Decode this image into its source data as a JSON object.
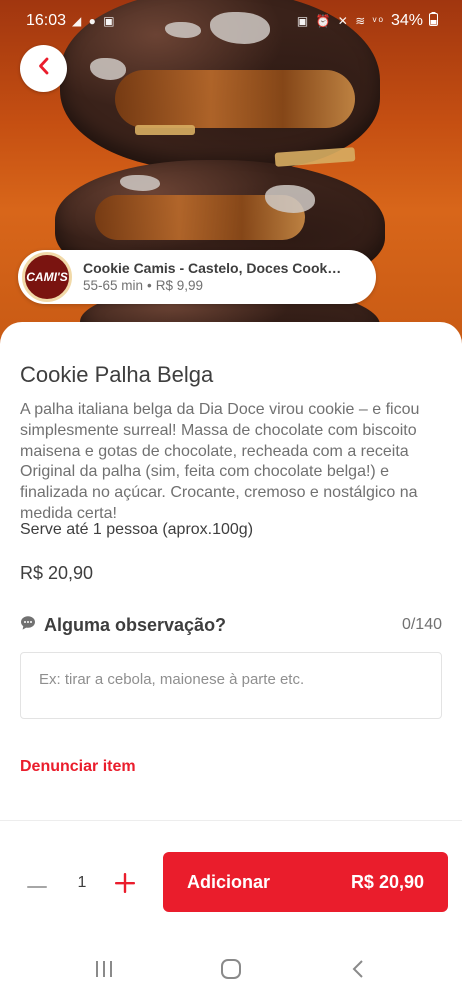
{
  "status_bar": {
    "time": "16:03",
    "notification_icons": "◢ ● ▣",
    "system_icons": "▣ ⏰ ✕ ≋ ᵛᵒ",
    "battery": "34%"
  },
  "merchant": {
    "logo_text": "CAMI'S",
    "name": "Cookie Camis - Castelo, Doces Cookies ...",
    "delivery_time": "55-65 min",
    "separator": "•",
    "delivery_fee": "R$ 9,99"
  },
  "product": {
    "title": "Cookie Palha Belga",
    "description": "A palha italiana belga da Dia Doce virou cookie – e ficou simplesmente surreal! Massa de chocolate com biscoito maisena e gotas de chocolate, recheada com a receita Original da palha (sim, feita com chocolate belga!) e finalizada no açúcar. Crocante, cremoso e nostálgico na medida certa!",
    "serves": "Serve até 1 pessoa (aprox.100g)",
    "price": "R$ 20,90"
  },
  "observation": {
    "label": "Alguma observação?",
    "counter": "0/140",
    "placeholder": "Ex: tirar a cebola, maionese à parte etc.",
    "value": ""
  },
  "report": {
    "label": "Denunciar item"
  },
  "cart": {
    "quantity": "1",
    "add_label": "Adicionar",
    "add_price": "R$ 20,90"
  },
  "colors": {
    "accent": "#ea1d2c",
    "text_primary": "#3e3e3e",
    "text_secondary": "#717171"
  },
  "icons": {
    "back": "chevron-left-icon",
    "observation": "chat-bubble-icon",
    "minus": "minus-icon",
    "plus": "plus-icon",
    "nav_recents": "recents-icon",
    "nav_home": "home-icon",
    "nav_back": "back-icon"
  }
}
